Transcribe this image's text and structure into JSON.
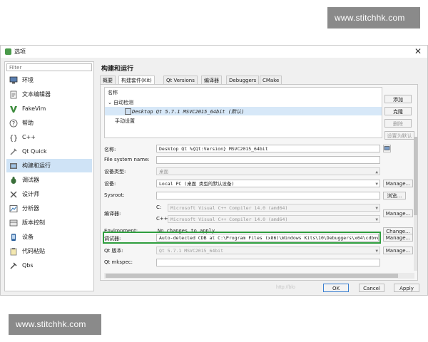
{
  "watermark": "www.stitchhk.com",
  "window": {
    "title": "选项",
    "close_symbol": "✕"
  },
  "sidebar": {
    "filter_placeholder": "Filter",
    "items": [
      {
        "label": "环境",
        "icon": "monitor-icon"
      },
      {
        "label": "文本编辑器",
        "icon": "text-editor-icon"
      },
      {
        "label": "FakeVim",
        "icon": "fakevim-icon"
      },
      {
        "label": "帮助",
        "icon": "help-icon"
      },
      {
        "label": "C++",
        "icon": "cpp-icon"
      },
      {
        "label": "Qt Quick",
        "icon": "qtquick-icon"
      },
      {
        "label": "构建和运行",
        "icon": "build-run-icon"
      },
      {
        "label": "调试器",
        "icon": "debugger-icon"
      },
      {
        "label": "设计师",
        "icon": "designer-icon"
      },
      {
        "label": "分析器",
        "icon": "analyzer-icon"
      },
      {
        "label": "版本控制",
        "icon": "version-control-icon"
      },
      {
        "label": "设备",
        "icon": "device-icon"
      },
      {
        "label": "代码粘贴",
        "icon": "code-paste-icon"
      },
      {
        "label": "Qbs",
        "icon": "qbs-icon"
      }
    ],
    "selected_index": 6
  },
  "pane": {
    "title": "构建和运行",
    "tabs": [
      "概要",
      "构建套件(Kit)",
      "Qt Versions",
      "编译器",
      "Debuggers",
      "CMake"
    ],
    "active_tab": 1
  },
  "kits": {
    "header": "名称",
    "auto_group": "自动检测",
    "auto_chevron": "⌄",
    "kit_name": "Desktop Qt 5.7.1 MSVC2015_64bit (默认)",
    "manual_group": "手动设置"
  },
  "side_buttons": {
    "add": "添加",
    "clone": "克隆",
    "remove": "删除",
    "set_default": "设置为默认"
  },
  "form": {
    "name_label": "名称:",
    "name_value": "Desktop Qt %{Qt:Version} MSVC2015_64bit",
    "filesystem_label": "File system name:",
    "device_type_label": "设备类型:",
    "device_type_value": "桌面",
    "device_label": "设备:",
    "device_value": "Local PC (桌面 类型的默认设备)",
    "sysroot_label": "Sysroot:",
    "browse_label": "浏览...",
    "compiler_label": "编译器:",
    "c_label": "C:",
    "c_value": "Microsoft Visual C++ Compiler 14.0 (amd64)",
    "cpp_label": "C++:",
    "cpp_value": "Microsoft Visual C++ Compiler 14.0 (amd64)",
    "environment_label": "Environment:",
    "environment_value": "No changes to apply.",
    "change_label": "Change...",
    "debugger_label": "调试器:",
    "debugger_value": "Auto-detected CDB at C:\\Program Files (x86)\\Windows Kits\\10\\Debuggers\\x64\\cdb.exe",
    "qt_version_label": "Qt 版本:",
    "qt_version_value": "Qt 5.7.1 MSVC2015_64bit",
    "qt_mkspec_label": "Qt mkspec:",
    "manage_label": "Manage...",
    "dropdown_arrow": "▼",
    "device_type_arrow": "▲"
  },
  "footer": {
    "blog_watermark": "http://blo",
    "ok": "OK",
    "cancel": "Cancel",
    "apply": "Apply"
  }
}
